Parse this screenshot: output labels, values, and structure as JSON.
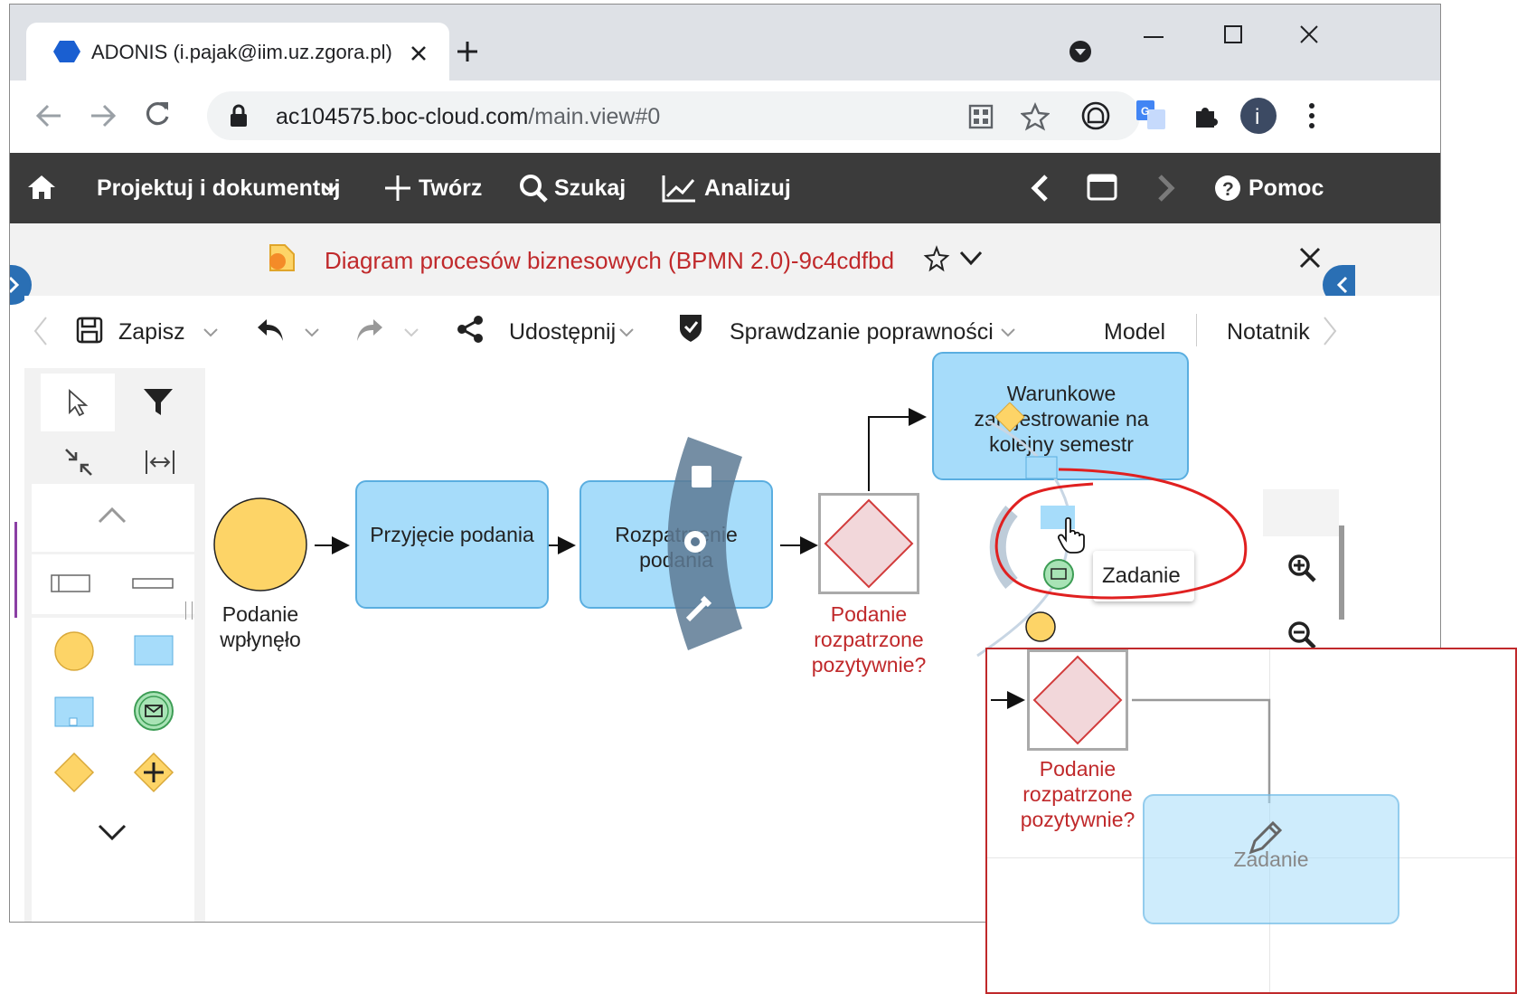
{
  "browser": {
    "tab_title": "ADONIS (i.pajak@iim.uz.zgora.pl)",
    "url_host": "ac104575.boc-cloud.com",
    "url_path": "/main.view#0"
  },
  "app_menu": {
    "design": "Projektuj i dokumentuj",
    "create": "Twórz",
    "search": "Szukaj",
    "analyze": "Analizuj",
    "help": "Pomoc"
  },
  "diagram": {
    "title": "Diagram procesów biznesowych (BPMN 2.0)-9c4cdfbd"
  },
  "model_toolbar": {
    "save": "Zapisz",
    "share": "Udostępnij",
    "validate": "Sprawdzanie poprawności",
    "tab_model": "Model",
    "tab_notebook": "Notatnik"
  },
  "canvas": {
    "start_event_label": "Podanie wpłynęło",
    "task1_label": "Przyjęcie podania",
    "task2_label": "Rozpatrzenie podania",
    "gateway_label": "Podanie rozpatrzone pozytywnie?",
    "task3_label": "Warunkowe zarejestrowanie na kolejny semestr",
    "tooltip": "Zadanie"
  },
  "inset": {
    "gateway_label": "Podanie rozpatrzone pozytywnie?",
    "ghost_task_label": "Zadanie"
  },
  "colors": {
    "task_fill": "#a6dcfa",
    "event_fill": "#fdd467",
    "gateway_fill": "#f2d7da",
    "accent_red": "#c0292b"
  }
}
